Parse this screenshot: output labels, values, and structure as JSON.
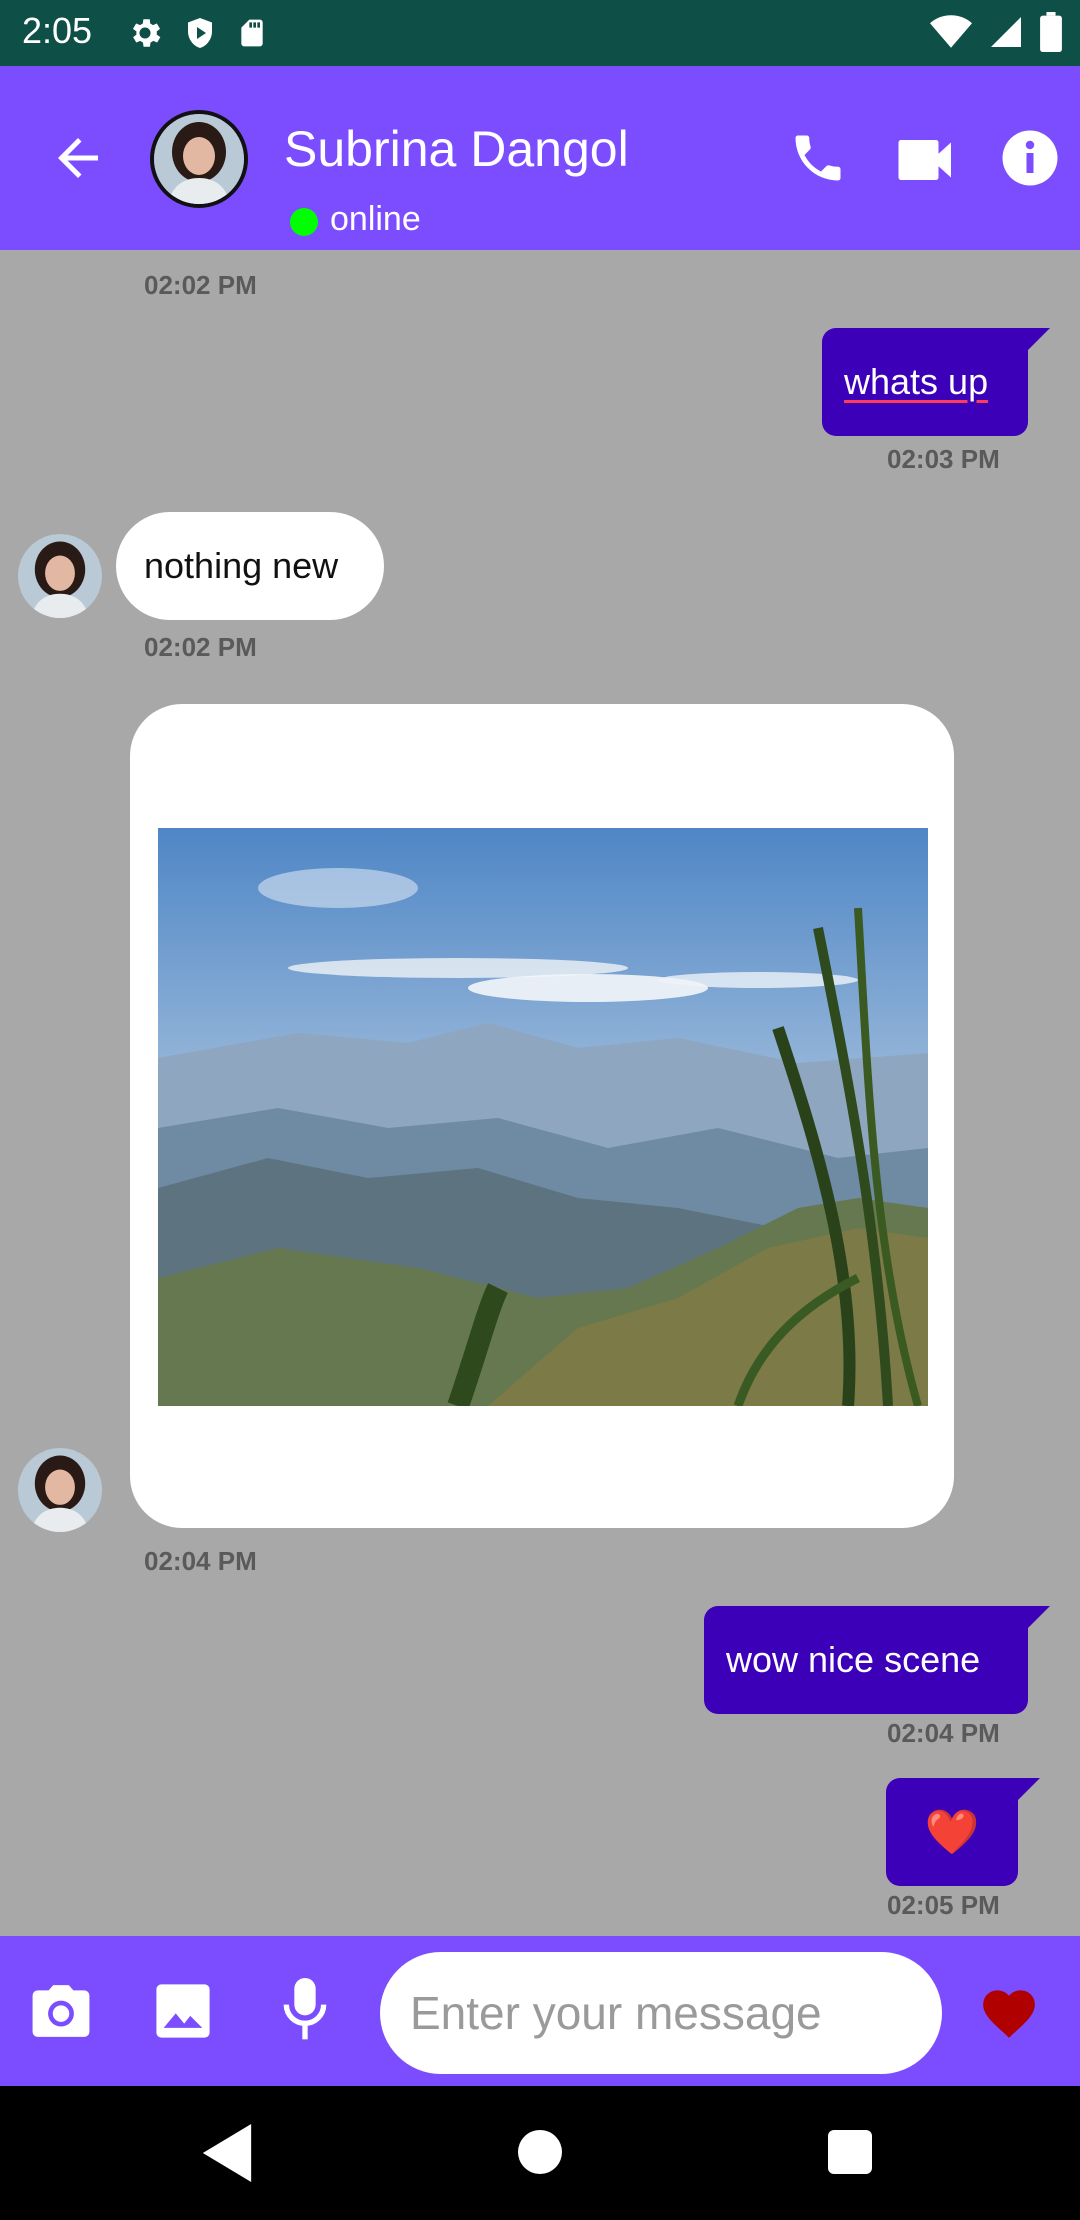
{
  "status_bar": {
    "time": "2:05",
    "icons": [
      "settings-icon",
      "shield-play-icon",
      "sd-card-icon",
      "wifi-icon",
      "signal-icon",
      "battery-icon"
    ]
  },
  "header": {
    "contact_name": "Subrina Dangol",
    "status": "online",
    "status_color": "#00ff00",
    "accent_color": "#7c4dff",
    "icons": [
      "back-arrow-icon",
      "phone-icon",
      "video-camera-icon",
      "info-icon"
    ]
  },
  "messages": [
    {
      "direction": "in",
      "time": "02:02 PM"
    },
    {
      "direction": "out",
      "text": "whats up",
      "time": "02:03 PM"
    },
    {
      "direction": "in",
      "text": "nothing new",
      "time": "02:02 PM"
    },
    {
      "direction": "in",
      "type": "image",
      "time": "02:04 PM"
    },
    {
      "direction": "out",
      "text": "wow nice scene",
      "time": "02:04 PM"
    },
    {
      "direction": "out",
      "text": "❤️",
      "time": "02:05 PM"
    }
  ],
  "outgoing_bubble_color": "#3b00b8",
  "composer": {
    "placeholder": "Enter your message",
    "icons": [
      "camera-icon",
      "gallery-icon",
      "microphone-icon",
      "heart-icon"
    ],
    "heart_color": "#b00000"
  },
  "nav_bar": {
    "icons": [
      "nav-back-icon",
      "nav-home-icon",
      "nav-recents-icon"
    ]
  }
}
